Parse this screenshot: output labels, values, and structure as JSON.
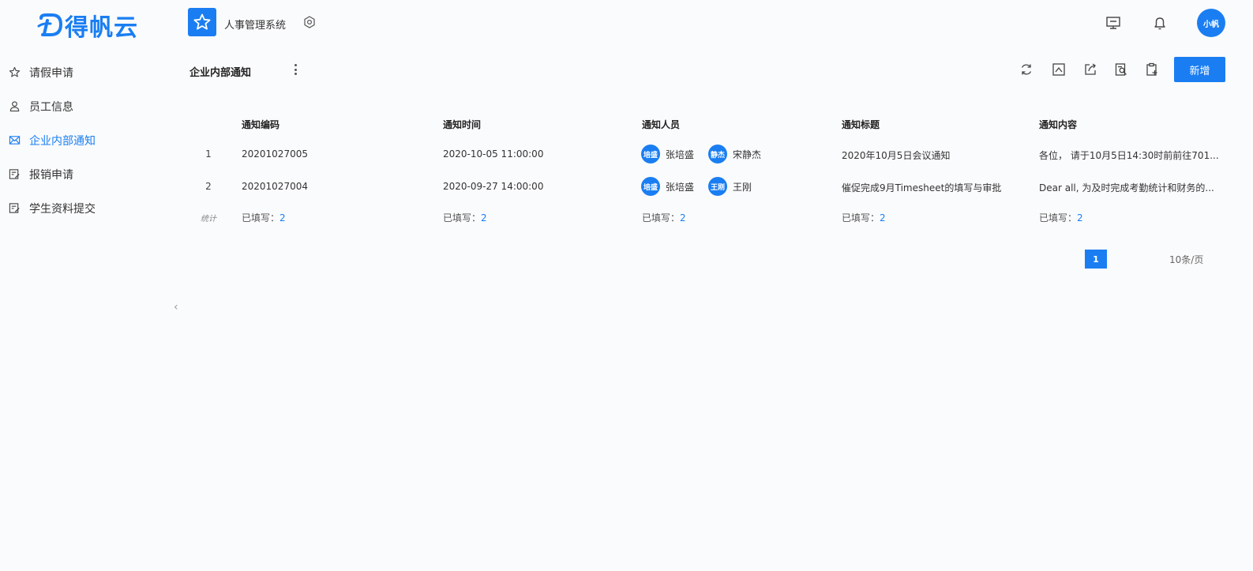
{
  "brand": {
    "logo_text": "得帆云",
    "accent": "#1a7ef2"
  },
  "header": {
    "app_name": "人事管理系统",
    "icons": [
      "monitor-icon",
      "bell-icon"
    ],
    "user_avatar": "小帆"
  },
  "sidebar": {
    "items": [
      {
        "label": "请假申请",
        "icon": "star-icon"
      },
      {
        "label": "员工信息",
        "icon": "user-icon"
      },
      {
        "label": "企业内部通知",
        "icon": "mail-icon",
        "active": true
      },
      {
        "label": "报销申请",
        "icon": "form-icon"
      },
      {
        "label": "学生资料提交",
        "icon": "form-icon"
      }
    ]
  },
  "page": {
    "title": "企业内部通知",
    "add_label": "新增",
    "toolbar_icons": [
      "refresh-icon",
      "import-icon",
      "export-icon",
      "search-doc-icon",
      "clipboard-icon"
    ]
  },
  "table": {
    "headers": [
      "通知编码",
      "通知时间",
      "通知人员",
      "通知标题",
      "通知内容"
    ],
    "rows": [
      {
        "index": "1",
        "code": "20201027005",
        "time": "2020-10-05 11:00:00",
        "people": [
          {
            "avatar": "培盛",
            "name": "张培盛"
          },
          {
            "avatar": "静杰",
            "name": "宋静杰"
          }
        ],
        "title": "2020年10月5日会议通知",
        "content": "各位， 请于10月5日14:30时前前往701..."
      },
      {
        "index": "2",
        "code": "20201027004",
        "time": "2020-09-27 14:00:00",
        "people": [
          {
            "avatar": "培盛",
            "name": "张培盛"
          },
          {
            "avatar": "王刚",
            "name": "王刚"
          }
        ],
        "title": "催促完成9月Timesheet的填写与审批",
        "content": "Dear all, 为及时完成考勤统计和财务的..."
      }
    ],
    "stats": {
      "label": "统计",
      "prefix": "已填写：",
      "values": [
        "2",
        "2",
        "2",
        "2",
        "2"
      ]
    }
  },
  "pagination": {
    "current": "1",
    "page_size": "10条/页"
  }
}
